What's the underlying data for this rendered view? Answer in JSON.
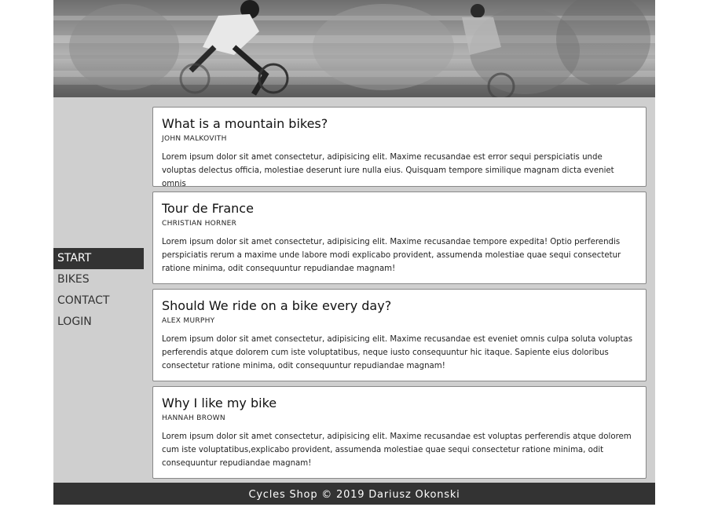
{
  "nav": {
    "items": [
      {
        "label": "START"
      },
      {
        "label": "BIKES"
      },
      {
        "label": "CONTACT"
      },
      {
        "label": "LOGIN"
      }
    ]
  },
  "articles": [
    {
      "title": "What is a mountain bikes?",
      "author": "JOHN MALKOVITH",
      "body": "Lorem ipsum dolor sit amet consectetur, adipisicing elit. Maxime recusandae est error sequi perspiciatis unde voluptas delectus officia, molestiae deserunt iure nulla eius. Quisquam tempore similique magnam dicta eveniet omnis"
    },
    {
      "title": "Tour de France",
      "author": "CHRISTIAN HORNER",
      "body": "Lorem ipsum dolor sit amet consectetur, adipisicing elit. Maxime recusandae tempore expedita! Optio perferendis perspiciatis rerum a maxime unde labore modi explicabo provident, assumenda molestiae quae sequi consectetur ratione minima, odit consequuntur repudiandae magnam!"
    },
    {
      "title": "Should We ride on a bike every day?",
      "author": "ALEX MURPHY",
      "body": "Lorem ipsum dolor sit amet consectetur, adipisicing elit. Maxime recusandae est eveniet omnis culpa soluta voluptas perferendis atque dolorem cum iste voluptatibus, neque iusto consequuntur hic itaque. Sapiente eius doloribus consectetur ratione minima, odit consequuntur repudiandae magnam!"
    },
    {
      "title": "Why I like my bike",
      "author": "HANNAH BROWN",
      "body": "Lorem ipsum dolor sit amet consectetur, adipisicing elit. Maxime recusandae est voluptas perferendis atque dolorem cum iste voluptatibus,explicabo provident, assumenda molestiae quae sequi consectetur ratione minima, odit consequuntur repudiandae magnam!"
    }
  ],
  "footer": {
    "text": "Cycles Shop © 2019 Dariusz Okonski"
  },
  "colors": {
    "page_background": "#cfcfcf",
    "nav_active": "#333333",
    "footer": "#333333"
  }
}
